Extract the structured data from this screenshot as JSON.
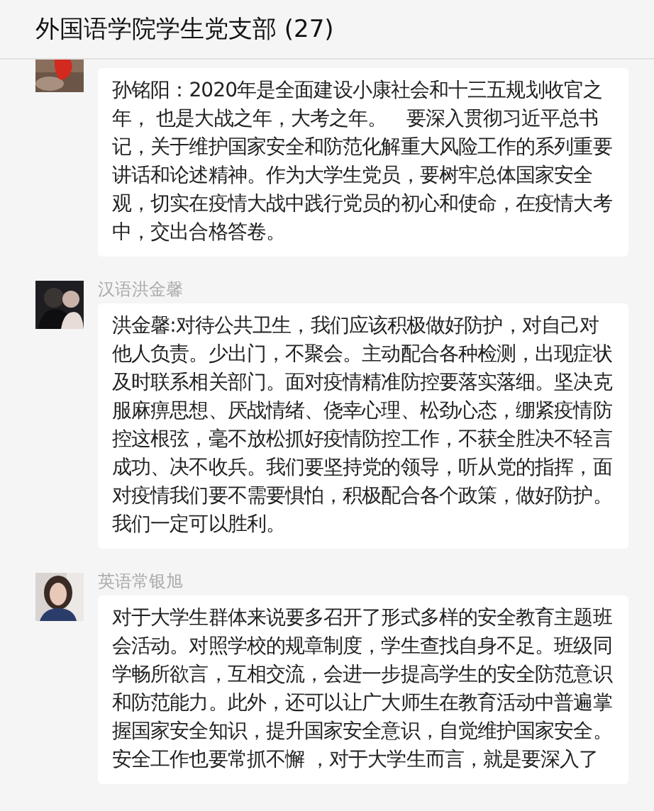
{
  "window": {
    "title": "外国语学院学生党支部 (27)"
  },
  "messages": [
    {
      "paragraphs": [
        "孙铭阳：2020年是全面建设小康社会和十三五规划收官之年， 也是大战之年，大考之年。　要深入贯彻习近平总书记，关于维护国家安全和防范化解重大风险工作的系列重要讲话和论述精神。作为大学生党员，要树牢总体国家安全观，切实在疫情大战中践行党员的初心和使命，在疫情大考中，交出合格答卷。"
      ]
    },
    {
      "sender": "汉语洪金馨",
      "paragraphs": [
        "洪金馨:对待公共卫生，我们应该积极做好防护，对自己对他人负责。少出门，不聚会。主动配合各种检测，出现症状及时联系相关部门。面对疫情精准防控要落实落细。坚决克服麻痹思想、厌战情绪、侥幸心理、松劲心态，绷紧疫情防控这根弦，毫不放松抓好疫情防控工作，不获全胜决不轻言成功、决不收兵。我们要坚持党的领导，听从党的指挥，面对疫情我们要不需要惧怕，积极配合各个政策，做好防护。我们一定可以胜利。"
      ]
    },
    {
      "sender": "英语常银旭",
      "paragraphs": [
        "对于大学生群体来说要多召开了形式多样的安全教育主题班会活动。对照学校的规章制度，学生查找自身不足。班级同学畅所欲言，互相交流，会进一步提高学生的安全防范意识和防范能力。此外，还可以让广大师生在教育活动中普遍掌握国家安全知识，提升国家安全意识，自觉维护国家安全。",
        "安全工作也要常抓不懈 ，对于大学生而言，就是要深入了"
      ]
    }
  ]
}
